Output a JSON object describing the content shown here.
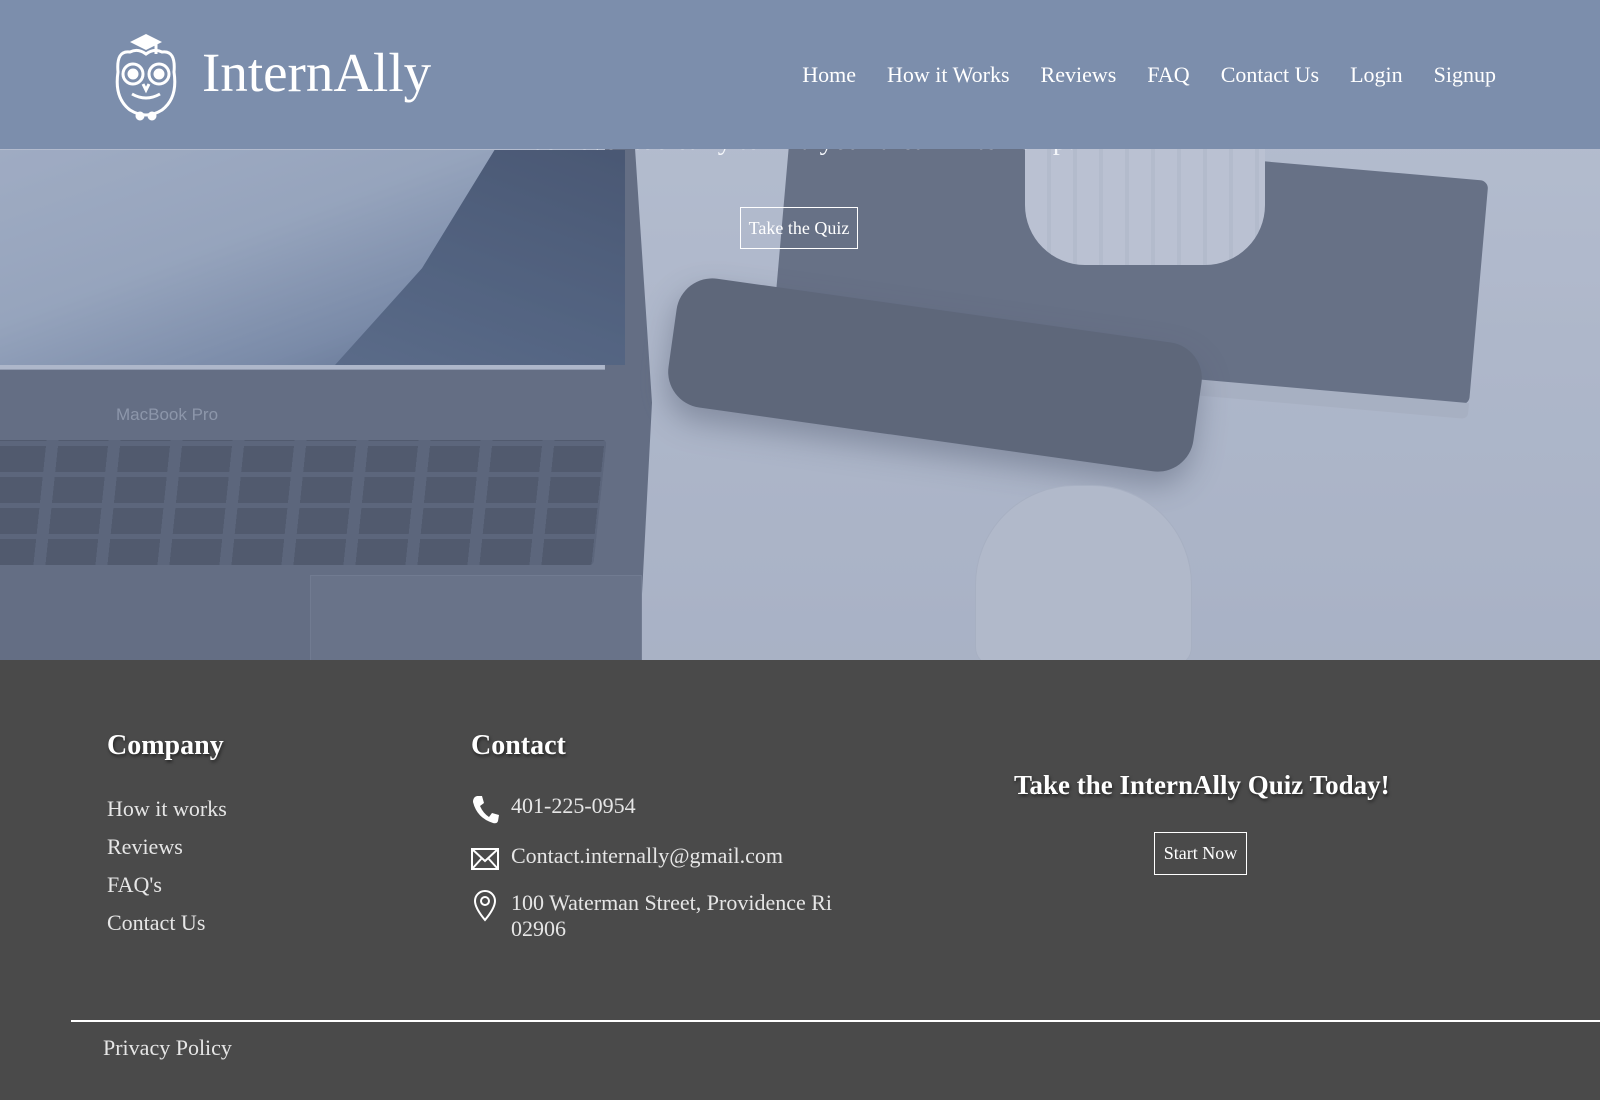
{
  "header": {
    "logo_text": "InternAlly",
    "nav": [
      "Home",
      "How it Works",
      "Reviews",
      "FAQ",
      "Contact Us",
      "Login",
      "Signup"
    ]
  },
  "hero": {
    "tagline": "It's never too early to find your dream internship!",
    "device_label": "MacBook Pro",
    "quiz_button": "Take the Quiz"
  },
  "footer": {
    "company": {
      "title": "Company",
      "links": [
        "How it works",
        "Reviews",
        "FAQ's",
        "Contact Us"
      ]
    },
    "contact": {
      "title": "Contact",
      "phone": "401-225-0954",
      "email": "Contact.internally@gmail.com",
      "address": "100 Waterman Street, Providence Ri 02906"
    },
    "cta": {
      "title": "Take the InternAlly Quiz Today!",
      "button": "Start Now"
    },
    "privacy": "Privacy Policy"
  },
  "colors": {
    "header_bg": "#7c8eac",
    "footer_bg": "#4a4a4a",
    "text_light": "#ffffff"
  },
  "icons": [
    "owl-graduate-logo-icon",
    "phone-icon",
    "mail-icon",
    "location-pin-icon"
  ]
}
